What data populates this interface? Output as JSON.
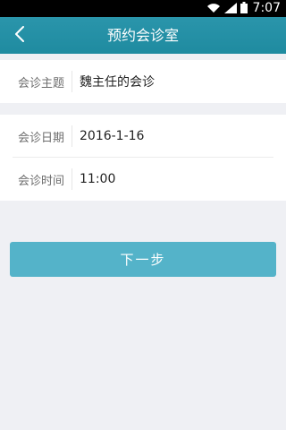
{
  "status_bar": {
    "time": "7:07",
    "icons": [
      "wifi-icon",
      "signal-icon",
      "battery-icon"
    ]
  },
  "header": {
    "title": "预约会诊室",
    "back_icon": "chevron-left-icon"
  },
  "form": {
    "topic": {
      "label": "会诊主题",
      "value": "魏主任的会诊"
    },
    "date": {
      "label": "会诊日期",
      "value": "2016-1-16"
    },
    "time": {
      "label": "会诊时间",
      "value": "11:00"
    }
  },
  "actions": {
    "next_label": "下一步"
  },
  "colors": {
    "nav_bar": "#1f8ba0",
    "button": "#54b3c9",
    "background": "#eff0f4"
  }
}
